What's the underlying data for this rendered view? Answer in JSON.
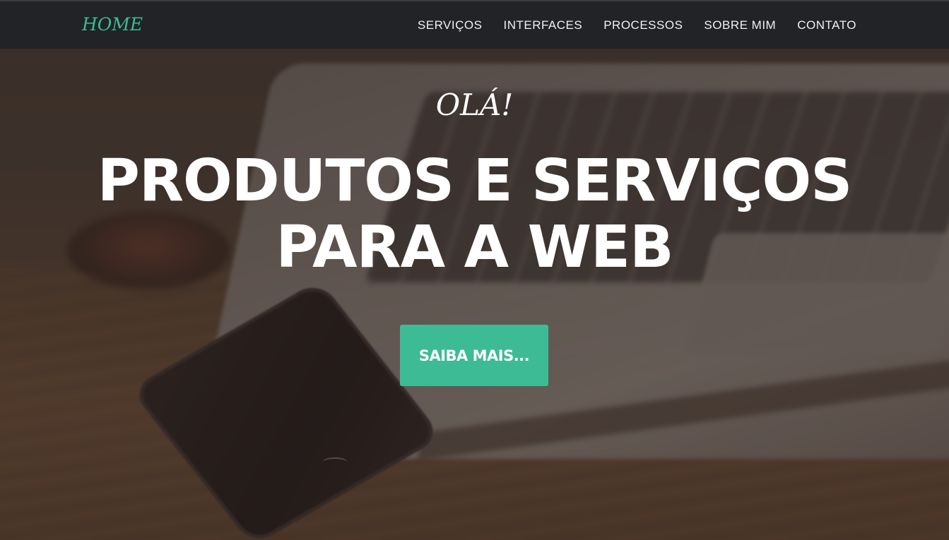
{
  "navbar": {
    "brand": "HOME",
    "links": [
      {
        "label": "SERVIÇOS"
      },
      {
        "label": "INTERFACES"
      },
      {
        "label": "PROCESSOS"
      },
      {
        "label": "SOBRE MIM"
      },
      {
        "label": "CONTATO"
      }
    ]
  },
  "hero": {
    "lead": "OLÁ!",
    "heading_line1": "PRODUTOS E SERVIÇOS",
    "heading_line2": "PARA A WEB",
    "cta_label": "SAIBA MAIS..."
  },
  "colors": {
    "accent": "#3dbb95",
    "navbar_bg": "#222327",
    "text": "#ffffff"
  }
}
